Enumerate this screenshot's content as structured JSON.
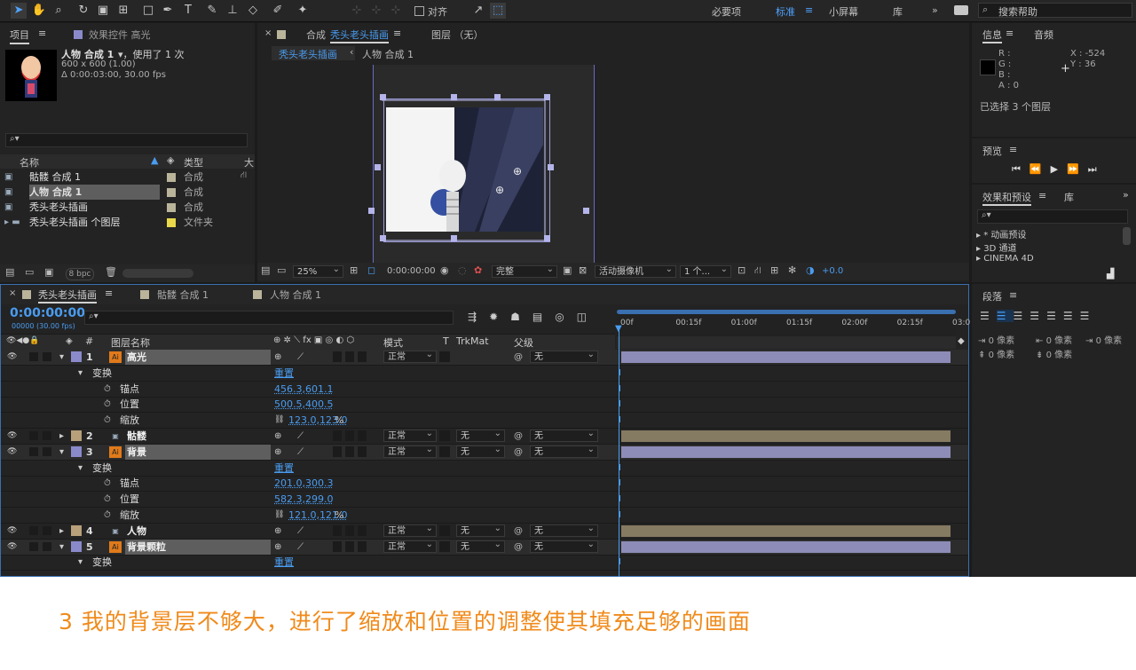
{
  "toolbar": {
    "align_label": "对齐",
    "workspaces": [
      "必要项",
      "标准",
      "小屏幕",
      "库"
    ],
    "active_workspace": "标准",
    "search_placeholder": "搜索帮助"
  },
  "project_panel": {
    "tab_project": "项目",
    "tab_effects": "效果控件 高光",
    "comp_name": "人物 合成 1",
    "used": "，使用了 1 次",
    "dims": "600 x 600 (1.00)",
    "duration": "Δ 0:00:03:00, 30.00 fps",
    "col_name": "名称",
    "col_type": "类型",
    "col_size": "大",
    "items": [
      {
        "name": "骷髅 合成 1",
        "type": "合成",
        "color": "#b9b49a",
        "kind": "comp"
      },
      {
        "name": "人物 合成 1",
        "type": "合成",
        "color": "#b9b49a",
        "kind": "comp",
        "selected": true
      },
      {
        "name": "秃头老头插画",
        "type": "合成",
        "color": "#b9b49a",
        "kind": "comp"
      },
      {
        "name": "秃头老头插画 个图层",
        "type": "文件夹",
        "color": "#e8d84a",
        "kind": "folder"
      }
    ],
    "bpc": "8 bpc"
  },
  "comp_panel": {
    "tab_prefix": "合成",
    "tab_active": "秃头老头插画",
    "tab_layer": "图层 （无）",
    "crumb_active": "秃头老头插画",
    "crumb_next": "人物 合成 1",
    "zoom": "25%",
    "timecode": "0:00:00:00",
    "quality": "完整",
    "camera": "活动摄像机",
    "views": "1 个...",
    "exposure": "+0.0"
  },
  "info_panel": {
    "tab_info": "信息",
    "tab_audio": "音频",
    "r": "R :",
    "g": "G :",
    "b": "B :",
    "a": "A : 0",
    "x": "X : -524",
    "y": "Y : 36",
    "selected": "已选择 3 个图层"
  },
  "preview_panel": {
    "title": "预览"
  },
  "effects_panel": {
    "title": "效果和预设",
    "tab_lib": "库",
    "items": [
      "* 动画预设",
      "3D 通道",
      "CINEMA 4D"
    ]
  },
  "paragraph_panel": {
    "title": "段落",
    "values": [
      "0 像素",
      "0 像素",
      "0 像素",
      "0 像素",
      "0 像素"
    ]
  },
  "timeline": {
    "tabs": [
      {
        "name": "秃头老头插画",
        "color": "#b9b49a",
        "active": true
      },
      {
        "name": "骷髅 合成 1",
        "color": "#b9b49a"
      },
      {
        "name": "人物 合成 1",
        "color": "#b9b49a"
      }
    ],
    "timecode": "0:00:00:00",
    "fps": "00000 (30.00 fps)",
    "headers": {
      "num": "#",
      "name": "图层名称",
      "mode": "模式",
      "t": "T",
      "trkmat": "TrkMat",
      "parent": "父级"
    },
    "ruler": [
      "00f",
      "00:15f",
      "01:00f",
      "01:15f",
      "02:00f",
      "02:15f",
      "03:0"
    ],
    "rows": [
      {
        "type": "layer",
        "num": "1",
        "name": "高光",
        "color": "#8a8acb",
        "icon": "ai",
        "mode": "正常",
        "trkmat": "",
        "parent": "无",
        "bar": "purple",
        "expanded": true,
        "selected": true
      },
      {
        "type": "group",
        "name": "变换",
        "reset": "重置"
      },
      {
        "type": "prop",
        "name": "锚点",
        "value": "456.3,601.1"
      },
      {
        "type": "prop",
        "name": "位置",
        "value": "500.5,400.5"
      },
      {
        "type": "prop",
        "name": "缩放",
        "value": "123.0,123.0",
        "unit": "%"
      },
      {
        "type": "layer",
        "num": "2",
        "name": "骷髅",
        "color": "#b7a07a",
        "icon": "comp",
        "mode": "正常",
        "trkmat": "无",
        "parent": "无",
        "bar": "tan"
      },
      {
        "type": "layer",
        "num": "3",
        "name": "背景",
        "color": "#8a8acb",
        "icon": "ai",
        "mode": "正常",
        "trkmat": "无",
        "parent": "无",
        "bar": "purple",
        "expanded": true,
        "selected": true
      },
      {
        "type": "group",
        "name": "变换",
        "reset": "重置"
      },
      {
        "type": "prop",
        "name": "锚点",
        "value": "201.0,300.3"
      },
      {
        "type": "prop",
        "name": "位置",
        "value": "582.3,299.0"
      },
      {
        "type": "prop",
        "name": "缩放",
        "value": "121.0,121.0",
        "unit": "%"
      },
      {
        "type": "layer",
        "num": "4",
        "name": "人物",
        "color": "#b7a07a",
        "icon": "comp",
        "mode": "正常",
        "trkmat": "无",
        "parent": "无",
        "bar": "tan"
      },
      {
        "type": "layer",
        "num": "5",
        "name": "背景颗粒",
        "color": "#8a8acb",
        "icon": "ai",
        "mode": "正常",
        "trkmat": "无",
        "parent": "无",
        "bar": "purple",
        "expanded": true,
        "selected": true
      },
      {
        "type": "group",
        "name": "变换",
        "reset": "重置"
      }
    ]
  },
  "caption": "3 我的背景层不够大，进行了缩放和位置的调整使其填充足够的画面",
  "colors": {
    "accent_blue": "#4a9cf0",
    "caption_orange": "#f08a1a",
    "bar_purple": "#8d8cb8",
    "bar_tan": "#857a62"
  }
}
